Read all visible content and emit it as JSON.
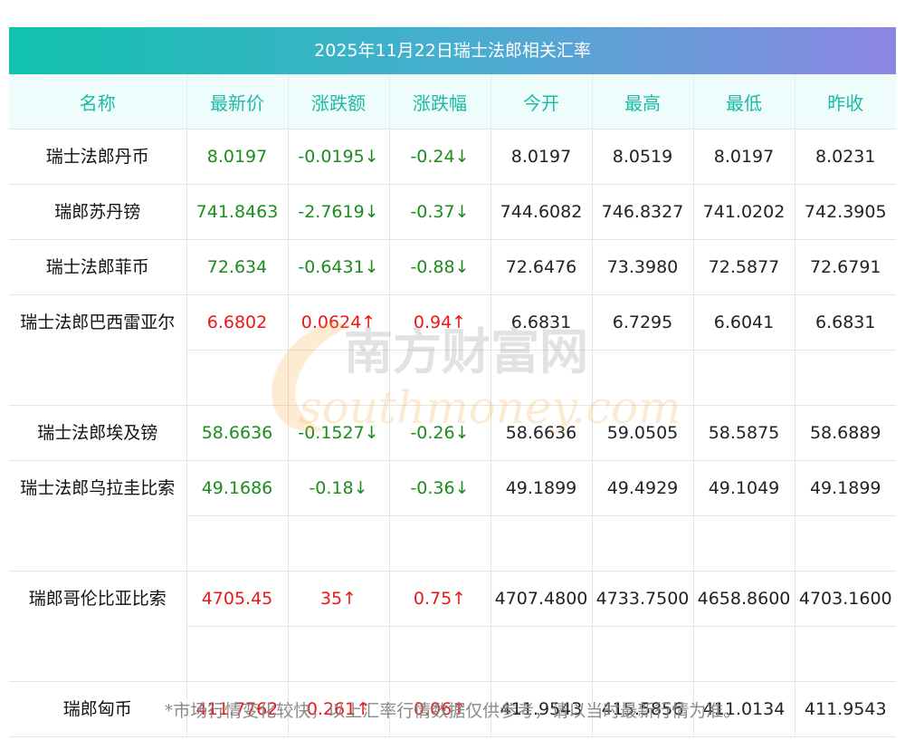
{
  "title": "2025年11月22日瑞士法郎相关汇率",
  "columns": [
    "名称",
    "最新价",
    "涨跌额",
    "涨跌幅",
    "今开",
    "最高",
    "最低",
    "昨收"
  ],
  "rows": [
    {
      "name": "瑞士法郎丹币",
      "latest": "8.0197",
      "change": "-0.0195↓",
      "pct": "-0.24↓",
      "open": "8.0197",
      "high": "8.0519",
      "low": "8.0197",
      "prev": "8.0231",
      "trend": "down"
    },
    {
      "name": "瑞郎苏丹镑",
      "latest": "741.8463",
      "change": "-2.7619↓",
      "pct": "-0.37↓",
      "open": "744.6082",
      "high": "746.8327",
      "low": "741.0202",
      "prev": "742.3905",
      "trend": "down"
    },
    {
      "name": "瑞士法郎菲币",
      "latest": "72.634",
      "change": "-0.6431↓",
      "pct": "-0.88↓",
      "open": "72.6476",
      "high": "73.3980",
      "low": "72.5877",
      "prev": "72.6791",
      "trend": "down"
    },
    {
      "name": "瑞士法郎巴西雷亚尔",
      "latest": "6.6802",
      "change": "0.0624↑",
      "pct": "0.94↑",
      "open": "6.6831",
      "high": "6.7295",
      "low": "6.6041",
      "prev": "6.6831",
      "trend": "up"
    },
    {
      "name": "瑞士法郎埃及镑",
      "latest": "58.6636",
      "change": "-0.1527↓",
      "pct": "-0.26↓",
      "open": "58.6636",
      "high": "59.0505",
      "low": "58.5875",
      "prev": "58.6889",
      "trend": "down"
    },
    {
      "name": "瑞士法郎乌拉圭比索",
      "latest": "49.1686",
      "change": "-0.18↓",
      "pct": "-0.36↓",
      "open": "49.1899",
      "high": "49.4929",
      "low": "49.1049",
      "prev": "49.1899",
      "trend": "down"
    },
    {
      "name": "瑞郎哥伦比亚比索",
      "latest": "4705.45",
      "change": "35↑",
      "pct": "0.75↑",
      "open": "4707.4800",
      "high": "4733.7500",
      "low": "4658.8600",
      "prev": "4703.1600",
      "trend": "up"
    },
    {
      "name": "瑞郎匈币",
      "latest": "411.7762",
      "change": "0.261↑",
      "pct": "0.06↑",
      "open": "411.9543",
      "high": "415.5856",
      "low": "411.0134",
      "prev": "411.9543",
      "trend": "up"
    }
  ],
  "watermark": {
    "text_cn": "南方财富网",
    "text_en": "southmoney.com"
  },
  "footer": "*市场行情变化较快，以上汇率行情数据仅供参考，请以当时最新行情为准。",
  "colors": {
    "up": "#e81818",
    "down": "#1c8c1c",
    "header_text": "#1dbaa6"
  }
}
